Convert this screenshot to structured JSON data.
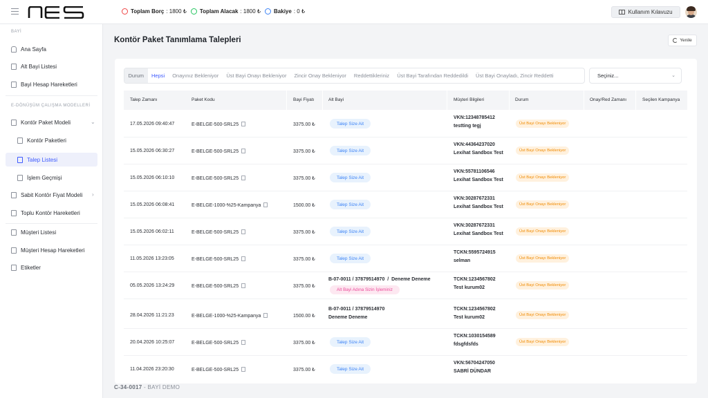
{
  "brand": {
    "logo_text": "nes"
  },
  "header": {
    "balances": [
      {
        "label": "Toplam Borç",
        "value": "1800 ₺",
        "color": "#ef4444",
        "icon": "minus-circle-icon"
      },
      {
        "label": "Toplam Alacak",
        "value": "1800 ₺",
        "color": "#22c55e",
        "icon": "check-circle-icon"
      },
      {
        "label": "Bakiye",
        "value": "0 ₺",
        "color": "#3b82f6",
        "icon": "info-circle-icon"
      }
    ],
    "guide_label": "Kullanım Kılavuzu"
  },
  "sidebar": {
    "section1": "BAYİ",
    "items": [
      {
        "label": "Ana Sayfa"
      },
      {
        "label": "Alt Bayi Listesi"
      },
      {
        "label": "Bayi Hesap Hareketleri"
      }
    ],
    "section2": "E-DÖNÜŞÜM ÇALIŞMA MODELLERİ",
    "items2": [
      {
        "label": "Kontör Paket Modeli"
      },
      {
        "label": "Kontör Paketleri"
      },
      {
        "label": "Talep Listesi"
      },
      {
        "label": "İşlem Geçmişi"
      },
      {
        "label": "Sabit Kontör Fiyat Modeli"
      },
      {
        "label": "Toplu Kontör Hareketleri"
      }
    ],
    "items3": [
      {
        "label": "Müşteri Listesi"
      },
      {
        "label": "Müşteri Hesap Hareketleri"
      },
      {
        "label": "Etiketler"
      }
    ]
  },
  "footer": {
    "code": "C-34-0017",
    "sep": " - ",
    "name": "BAYİ DEMO"
  },
  "main": {
    "title": "Kontör Paket Tanımlama Talepleri",
    "refresh_label": "Yenile",
    "tabs": [
      "Durum",
      "Hepsi",
      "Onayınız Bekleniyor",
      "Üst Bayi Onayı Bekleniyor",
      "Zincir Onay Bekleniyor",
      "Reddettikleriniz",
      "Üst Bayi Tarafından Reddedildi",
      "Üst Bayi Onayladı, Zincir Reddetti"
    ],
    "select_placeholder": "Seçiniz...",
    "columns": [
      "Talep Zamanı",
      "Paket Kodu",
      "Bayi Fiyatı",
      "Alt Bayi",
      "Müşteri Bilgileri",
      "Durum",
      "Onay/Red Zamanı",
      "Seçilen Kampanya"
    ],
    "rows": [
      {
        "time": "17.05.2026 09:40:47",
        "code": "E-BELGE-500-SRL25",
        "price": "3375.00 ₺",
        "subdealer_pill": "Talep Size Ait",
        "cust_id": "VKN:12348785412",
        "cust_name": "testting tegj",
        "status": "Üst Bayi Onayı Bekleniyor"
      },
      {
        "time": "15.05.2026 06:30:27",
        "code": "E-BELGE-500-SRL25",
        "price": "3375.00 ₺",
        "subdealer_pill": "Talep Size Ait",
        "cust_id": "VKN:44364237020",
        "cust_name": "Lexihat Sandbox Test",
        "status": "Üst Bayi Onayı Bekleniyor"
      },
      {
        "time": "15.05.2026 06:10:10",
        "code": "E-BELGE-500-SRL25",
        "price": "3375.00 ₺",
        "subdealer_pill": "Talep Size Ait",
        "cust_id": "VKN:55781106546",
        "cust_name": "Lexihat Sandbox Test",
        "status": "Üst Bayi Onayı Bekleniyor"
      },
      {
        "time": "15.05.2026 06:08:41",
        "code": "E-BELGE-1000-%25-Kampanya",
        "price": "1500.00 ₺",
        "subdealer_pill": "Talep Size Ait",
        "cust_id": "VKN:30287672331",
        "cust_name": "Lexihat Sandbox Test",
        "status": "Üst Bayi Onayı Bekleniyor"
      },
      {
        "time": "15.05.2026 06:02:11",
        "code": "E-BELGE-500-SRL25",
        "price": "3375.00 ₺",
        "subdealer_pill": "Talep Size Ait",
        "cust_id": "VKN:30287672331",
        "cust_name": "Lexihat Sandbox Test",
        "status": "Üst Bayi Onayı Bekleniyor"
      },
      {
        "time": "11.05.2026 13:23:05",
        "code": "E-BELGE-500-SRL25",
        "price": "3375.00 ₺",
        "subdealer_pill": "Talep Size Ait",
        "cust_id": "TCKN:5595724915",
        "cust_name": "selman",
        "status": "Üst Bayi Onayı Bekleniyor"
      },
      {
        "time": "05.05.2026 13:24:29",
        "code": "E-BELGE-500-SRL25",
        "price": "3375.00 ₺",
        "subdealer_text": "B-07-0011 / 37879514970",
        "subdealer_sep": "/",
        "subdealer_name": "Deneme Deneme",
        "subdealer_pill_pink": "Alt Bayi Adına Sizin İşleminiz",
        "cust_id": "TCKN:1234567802",
        "cust_name": "Test kurum02",
        "status": "Üst Bayi Onayı Bekleniyor"
      },
      {
        "time": "28.04.2026 11:21:23",
        "code": "E-BELGE-1000-%25-Kampanya",
        "price": "1500.00 ₺",
        "subdealer_text": "B-07-0011 / 37879514970",
        "subdealer_name": "Deneme Deneme",
        "cust_id": "TCKN:1234567802",
        "cust_name": "Test kurum02",
        "status": "Üst Bayi Onayı Bekleniyor"
      },
      {
        "time": "20.04.2026 10:25:07",
        "code": "E-BELGE-500-SRL25",
        "price": "3375.00 ₺",
        "subdealer_pill": "Talep Size Ait",
        "cust_id": "TCKN:1030154589",
        "cust_name": "fdsgfdsfds",
        "status": "Üst Bayi Onayı Bekleniyor"
      },
      {
        "time": "11.04.2026 23:20:30",
        "code": "E-BELGE-500-SRL25",
        "price": "3375.00 ₺",
        "subdealer_pill": "Talep Size Ait",
        "cust_id": "VKN:56704247050",
        "cust_name": "SABRİ DÜNDAR",
        "status": ""
      }
    ]
  }
}
